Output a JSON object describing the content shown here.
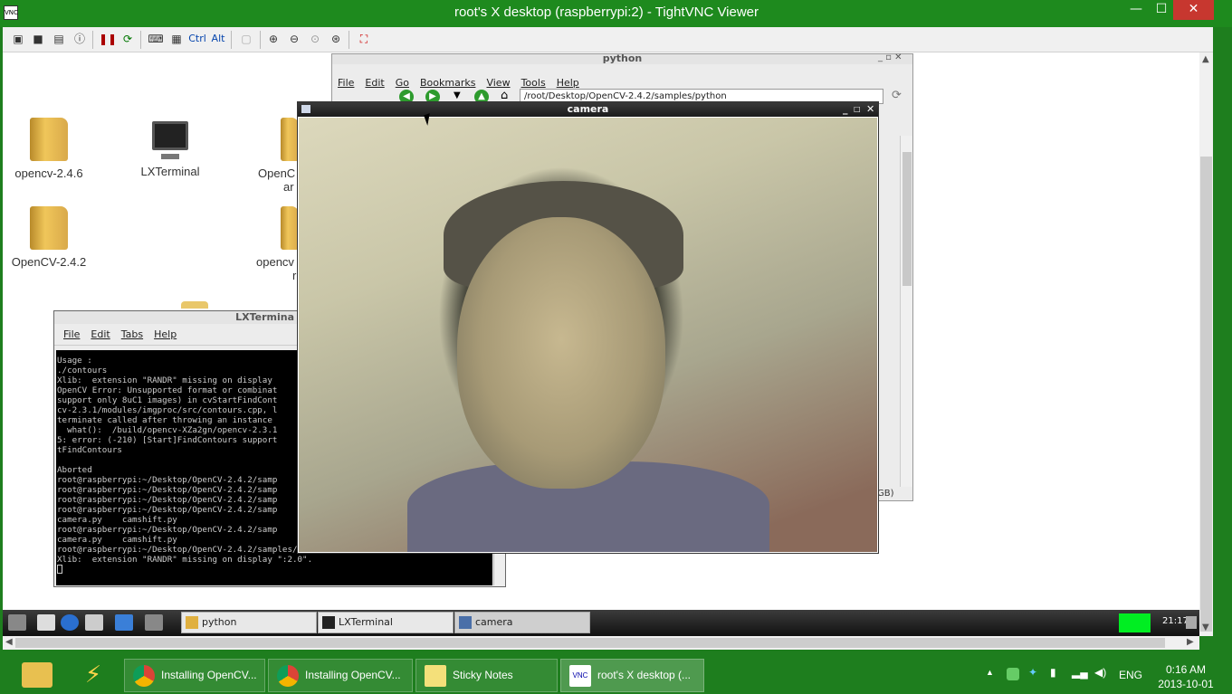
{
  "vnc": {
    "title": "root's X desktop (raspberrypi:2) - TightVNC Viewer",
    "min": "—",
    "max": "☐",
    "close": "✕",
    "toolbar": [
      "new-connection",
      "save",
      "options",
      "info",
      "pause",
      "refresh",
      "ctrl-alt-del",
      "send-special",
      "Ctrl",
      "Alt",
      "clipboard",
      "zoom-in",
      "zoom-out",
      "zoom-100",
      "zoom-fit",
      "fullscreen"
    ]
  },
  "desktop": {
    "icons": [
      {
        "label": "opencv-2.4.6"
      },
      {
        "label": "LXTerminal"
      },
      {
        "label": "OpenC"
      },
      {
        "label": "ar"
      },
      {
        "label": "OpenCV-2.4.2"
      },
      {
        "label": "opencv"
      },
      {
        "label": "r"
      }
    ]
  },
  "python_window": {
    "title": "python",
    "menu": [
      "File",
      "Edit",
      "Go",
      "Bookmarks",
      "View",
      "Tools",
      "Help"
    ],
    "path": "/root/Desktop/OpenCV-2.4.2/samples/python",
    "status": "GB)"
  },
  "camera_window": {
    "title": "camera",
    "controls": [
      "_",
      "□",
      "✕"
    ]
  },
  "terminal": {
    "title": "LXTermina",
    "menu": [
      "File",
      "Edit",
      "Tabs",
      "Help"
    ],
    "lines": [
      "Usage :",
      "./contours",
      "Xlib:  extension \"RANDR\" missing on display",
      "OpenCV Error: Unsupported format or combinat",
      "support only 8uC1 images) in cvStartFindCont",
      "cv-2.3.1/modules/imgproc/src/contours.cpp, l",
      "terminate called after throwing an instance",
      "  what():  /build/opencv-XZa2gn/opencv-2.3.1",
      "5: error: (-210) [Start]FindContours support",
      "tFindContours",
      "",
      "Aborted",
      "root@raspberrypi:~/Desktop/OpenCV-2.4.2/samp",
      "root@raspberrypi:~/Desktop/OpenCV-2.4.2/samp",
      "root@raspberrypi:~/Desktop/OpenCV-2.4.2/samp",
      "root@raspberrypi:~/Desktop/OpenCV-2.4.2/samp",
      "camera.py    camshift.py",
      "root@raspberrypi:~/Desktop/OpenCV-2.4.2/samp",
      "camera.py    camshift.py",
      "root@raspberrypi:~/Desktop/OpenCV-2.4.2/samples/python# python camera.py",
      "Xlib:  extension \"RANDR\" missing on display \":2.0\"."
    ]
  },
  "lx_panel": {
    "tasks": [
      "python",
      "LXTerminal",
      "camera"
    ],
    "clock": "21:17"
  },
  "win_taskbar": {
    "items": [
      "Installing OpenCV...",
      "Installing OpenCV...",
      "Sticky Notes",
      "root's X desktop (..."
    ],
    "lang": "ENG",
    "time": "0:16 AM",
    "date": "2013-10-01"
  },
  "colors": {
    "taskbar": "#1e7e1e",
    "close": "#c7372f"
  }
}
